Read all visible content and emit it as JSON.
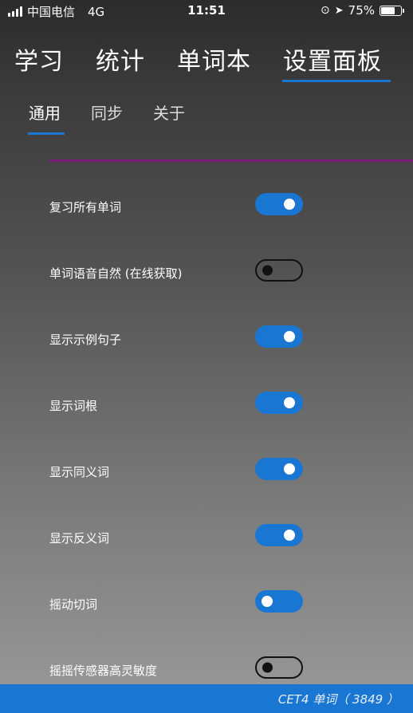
{
  "status_bar": {
    "carrier": "中国电信",
    "network": "4G",
    "time": "11:51",
    "battery": "75%",
    "battery_level": 0.75
  },
  "main_tabs": [
    "学习",
    "统计",
    "单词本",
    "设置面板"
  ],
  "main_tab_selected": "设置面板",
  "sub_tabs": [
    "通用",
    "同步",
    "关于"
  ],
  "sub_tab_selected": "通用",
  "colors": {
    "accent": "#1976d2",
    "divider": "#7b1a78"
  },
  "settings": [
    {
      "label": "复习所有单词",
      "state": "on"
    },
    {
      "label": "单词语音自然 (在线获取)",
      "state": "off"
    },
    {
      "label": "显示示例句子",
      "state": "on"
    },
    {
      "label": "显示词根",
      "state": "on"
    },
    {
      "label": "显示同义词",
      "state": "on"
    },
    {
      "label": "显示反义词",
      "state": "on"
    },
    {
      "label": "摇动切词",
      "state": "on-knob-left"
    },
    {
      "label": "摇摇传感器高灵敏度",
      "state": "off"
    }
  ],
  "bottom_bar": {
    "text": "CET4 单词（ 3849 ）"
  }
}
